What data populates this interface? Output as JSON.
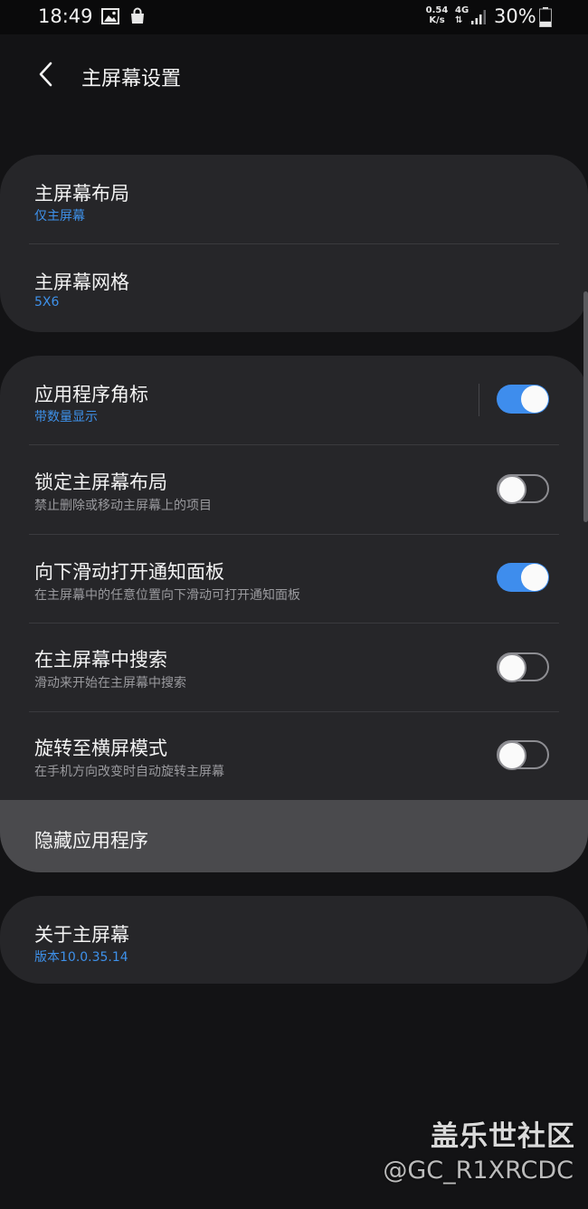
{
  "status_bar": {
    "time": "18:49",
    "net_speed_value": "0.54",
    "net_speed_unit": "K/s",
    "net_type": "4G",
    "battery_percent": "30%",
    "battery_level": 0.3
  },
  "header": {
    "title": "主屏幕设置"
  },
  "group1": [
    {
      "title": "主屏幕布局",
      "subtitle": "仅主屏幕"
    },
    {
      "title": "主屏幕网格",
      "subtitle": "5X6"
    }
  ],
  "group2": [
    {
      "title": "应用程序角标",
      "subtitle": "带数量显示",
      "toggle": true
    },
    {
      "title": "锁定主屏幕布局",
      "subtitle": "禁止删除或移动主屏幕上的项目",
      "toggle": false
    },
    {
      "title": "向下滑动打开通知面板",
      "subtitle": "在主屏幕中的任意位置向下滑动可打开通知面板",
      "toggle": true
    },
    {
      "title": "在主屏幕中搜索",
      "subtitle": "滑动来开始在主屏幕中搜索",
      "toggle": false
    },
    {
      "title": "旋转至横屏模式",
      "subtitle": "在手机方向改变时自动旋转主屏幕",
      "toggle": false
    },
    {
      "title": "隐藏应用程序"
    }
  ],
  "group3": [
    {
      "title": "关于主屏幕",
      "subtitle": "版本10.0.35.14"
    }
  ],
  "watermark": {
    "site": "盖乐世社区",
    "user": "@GC_R1XRCDC"
  },
  "colors": {
    "background": "#131315",
    "card": "#262629",
    "accent": "#3e91ea",
    "toggle_on": "#3e8ded",
    "highlight_row": "#4a4a4d"
  }
}
